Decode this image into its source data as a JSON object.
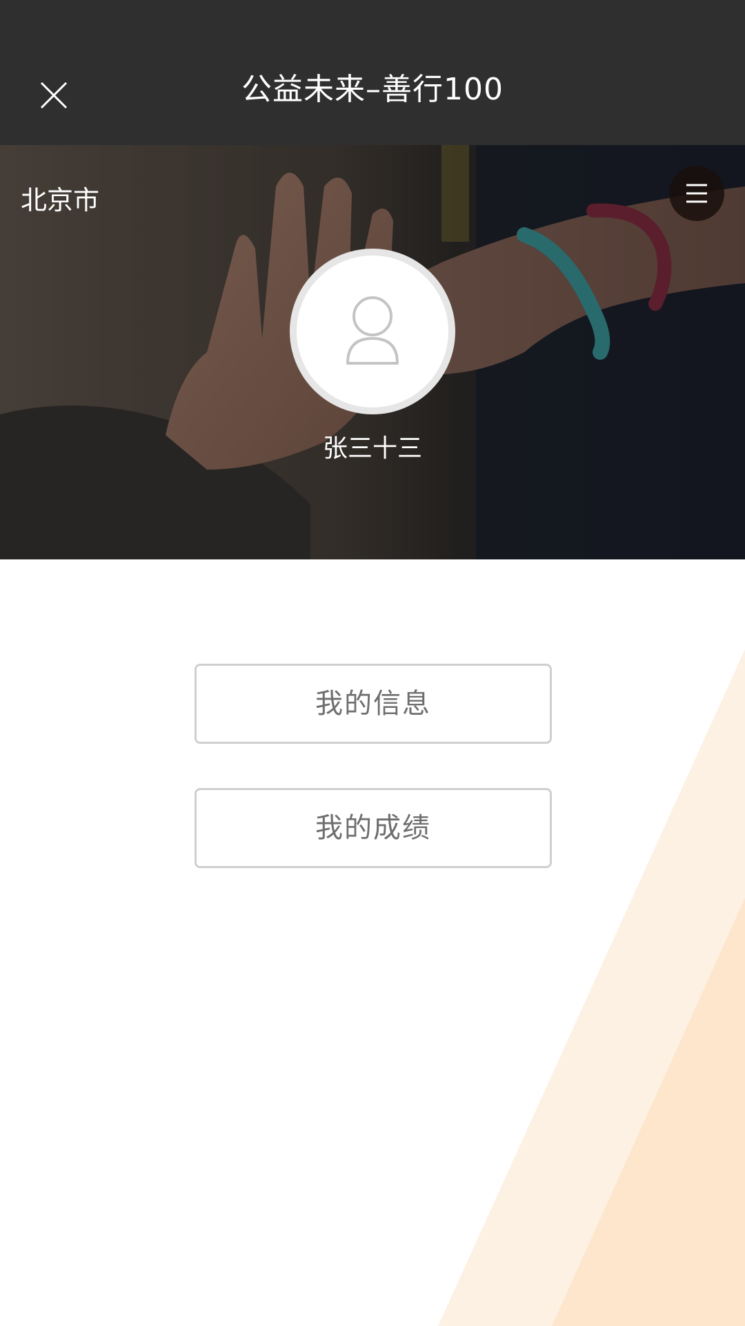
{
  "header": {
    "title": "公益未来–善行100",
    "close_icon": "close-icon"
  },
  "banner": {
    "city": "北京市",
    "menu_icon": "hamburger-menu-icon",
    "avatar_icon": "user-avatar-icon",
    "user_name": "张三十三"
  },
  "actions": {
    "my_info_label": "我的信息",
    "my_score_label": "我的成绩"
  },
  "colors": {
    "topbar": "#2f2f30",
    "button_border": "#cfcfcf",
    "button_text": "#6e6e6e",
    "decor_light": "#fdf1e3",
    "decor_dark": "#fde6cc"
  }
}
